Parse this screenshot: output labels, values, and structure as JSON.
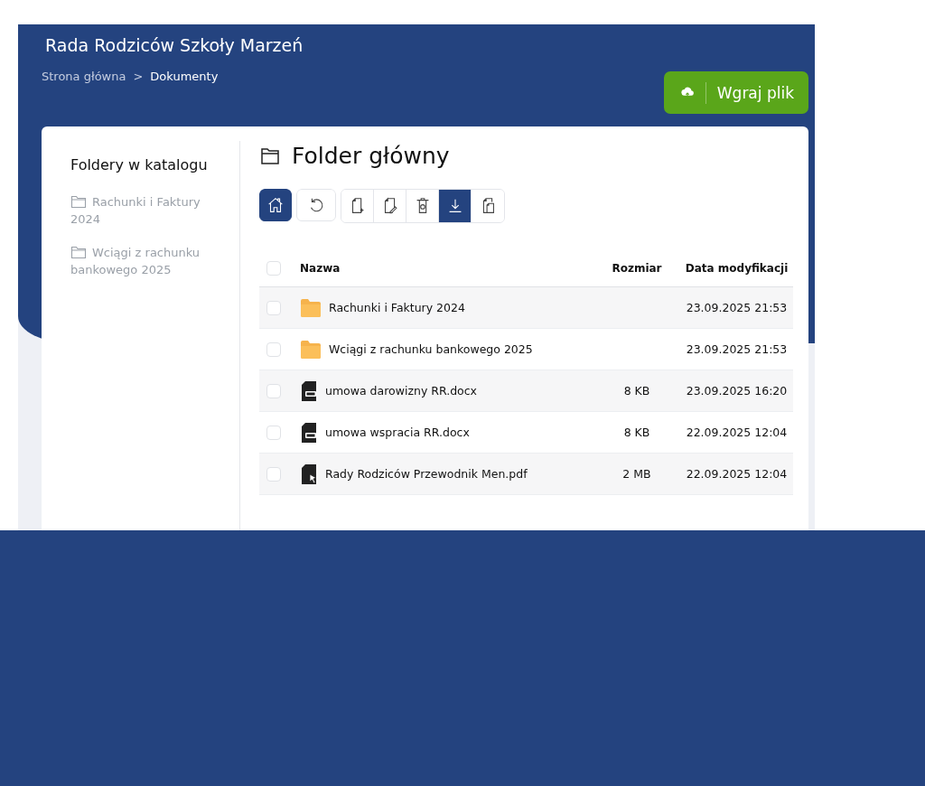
{
  "header": {
    "title": "Rada Rodziców Szkoły Marzeń",
    "breadcrumb": [
      {
        "label": "Strona główna",
        "current": false
      },
      {
        "label": ">",
        "current": false
      },
      {
        "label": "Dokumenty",
        "current": true
      }
    ],
    "upload_button": "Wgraj plik"
  },
  "sidebar": {
    "title": "Foldery w katalogu",
    "items": [
      {
        "label": "Rachunki i Faktury 2024"
      },
      {
        "label": "Wciągi z rachunku bankowego 2025"
      }
    ]
  },
  "main": {
    "title": "Folder główny",
    "toolbar": [
      [
        {
          "kind": "home",
          "active": true
        }
      ],
      [
        {
          "kind": "refresh",
          "active": false
        }
      ],
      [
        {
          "kind": "new-file",
          "active": false
        },
        {
          "kind": "edit",
          "active": false
        },
        {
          "kind": "delete",
          "active": false
        },
        {
          "kind": "download",
          "active": true
        },
        {
          "kind": "copy",
          "active": false
        }
      ]
    ],
    "table": {
      "select_all_checked": false,
      "columns": [
        "Nazwa",
        "Rozmiar",
        "Data modyfikacji"
      ],
      "rows": [
        {
          "kind": "folder",
          "checked": false,
          "name": "Rachunki i Faktury 2024",
          "size": "",
          "date": "23.09.2025 21:53"
        },
        {
          "kind": "folder",
          "checked": false,
          "name": "Wciągi z rachunku bankowego 2025",
          "size": "",
          "date": "23.09.2025 21:53"
        },
        {
          "kind": "doc",
          "checked": false,
          "name": "umowa darowizny RR.docx",
          "size": "8 KB",
          "date": "23.09.2025 16:20"
        },
        {
          "kind": "doc",
          "checked": false,
          "name": "umowa wspracia RR.docx",
          "size": "8 KB",
          "date": "22.09.2025 12:04"
        },
        {
          "kind": "pdf",
          "checked": false,
          "name": "Rady Rodziców Przewodnik Men.pdf",
          "size": "2 MB",
          "date": "22.09.2025 12:04"
        }
      ]
    }
  }
}
